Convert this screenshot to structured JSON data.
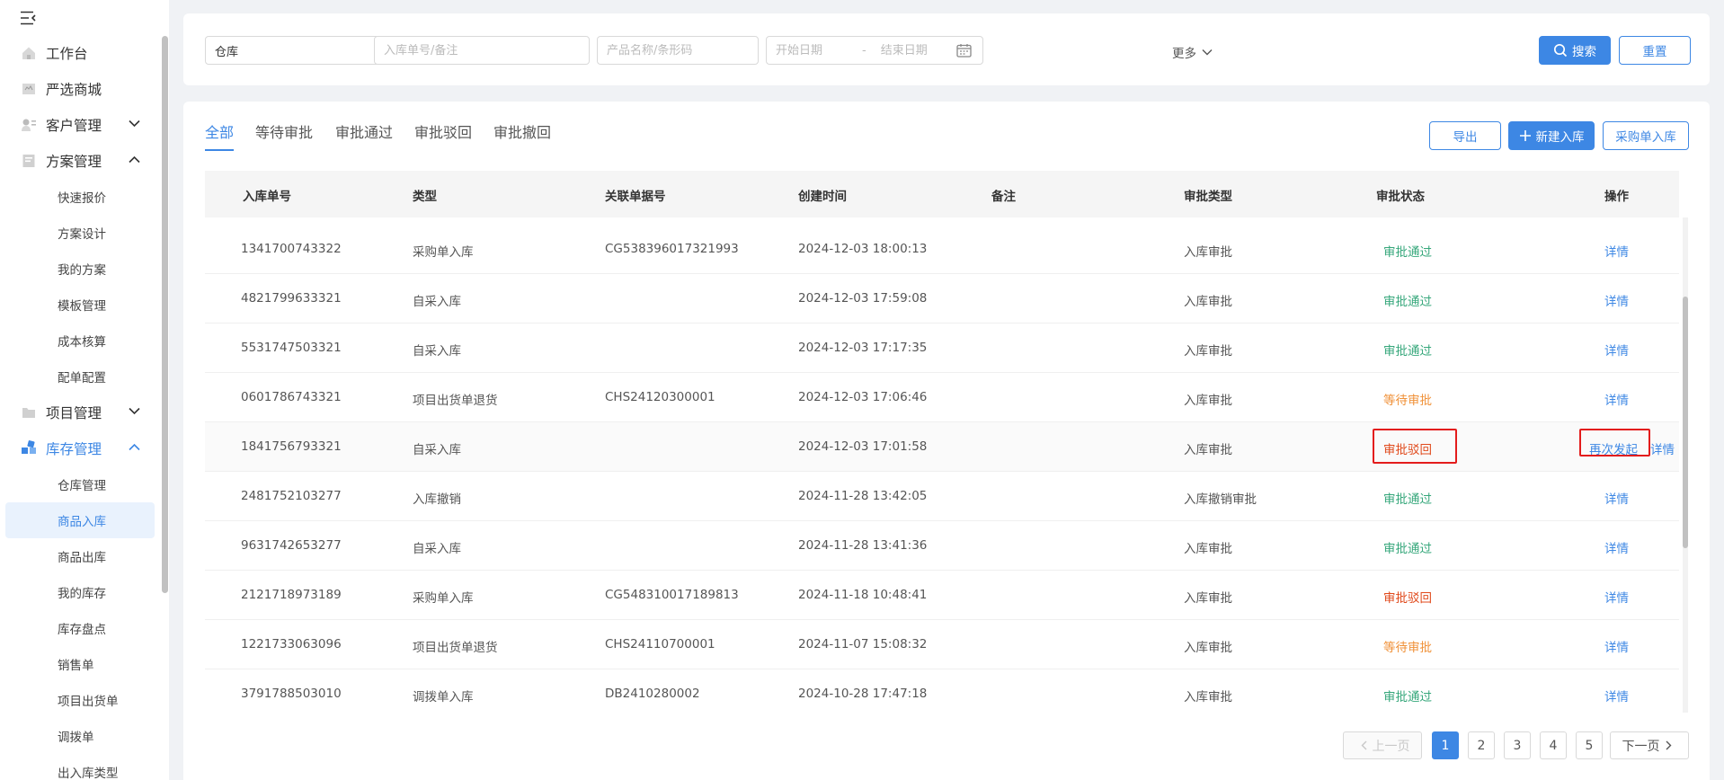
{
  "sidebar": {
    "nav": [
      {
        "label": "工作台",
        "icon": "home-icon"
      },
      {
        "label": "严选商城",
        "icon": "mall-icon"
      },
      {
        "label": "客户管理",
        "icon": "customer-icon",
        "expanded": false
      },
      {
        "label": "方案管理",
        "icon": "plan-icon",
        "expanded": true
      },
      {
        "label": "项目管理",
        "icon": "folder-icon",
        "expanded": false
      },
      {
        "label": "库存管理",
        "icon": "inventory-icon",
        "expanded": true
      }
    ],
    "plan_sub": [
      "快速报价",
      "方案设计",
      "我的方案",
      "模板管理",
      "成本核算",
      "配单配置"
    ],
    "inventory_sub": [
      "仓库管理",
      "商品入库",
      "商品出库",
      "我的库存",
      "库存盘点",
      "销售单",
      "项目出货单",
      "调拨单",
      "出入库类型"
    ],
    "selected": "商品入库"
  },
  "filters": {
    "warehouse": "仓库",
    "order_placeholder": "入库单号/备注",
    "product_placeholder": "产品名称/条形码",
    "start_placeholder": "开始日期",
    "date_sep": "-",
    "end_placeholder": "结束日期",
    "more_label": "更多",
    "search_label": "搜索",
    "reset_label": "重置"
  },
  "tabs": [
    "全部",
    "等待审批",
    "审批通过",
    "审批驳回",
    "审批撤回"
  ],
  "actions": {
    "export_label": "导出",
    "new_label": "新建入库",
    "purchase_label": "采购单入库"
  },
  "table": {
    "headers": [
      "入库单号",
      "类型",
      "关联单据号",
      "创建时间",
      "备注",
      "审批类型",
      "审批状态",
      "操作"
    ],
    "rows": [
      {
        "id": "1341700743322",
        "type": "采购单入库",
        "ref": "CG538396017321993",
        "time": "2024-12-03 18:00:13",
        "note": "",
        "approval_type": "入库审批",
        "status": "审批通过",
        "status_kind": "pass",
        "action": "详情"
      },
      {
        "id": "4821799633321",
        "type": "自采入库",
        "ref": "",
        "time": "2024-12-03 17:59:08",
        "note": "",
        "approval_type": "入库审批",
        "status": "审批通过",
        "status_kind": "pass",
        "action": "详情"
      },
      {
        "id": "5531747503321",
        "type": "自采入库",
        "ref": "",
        "time": "2024-12-03 17:17:35",
        "note": "",
        "approval_type": "入库审批",
        "status": "审批通过",
        "status_kind": "pass",
        "action": "详情"
      },
      {
        "id": "0601786743321",
        "type": "项目出货单退货",
        "ref": "CHS24120300001",
        "time": "2024-12-03 17:06:46",
        "note": "",
        "approval_type": "入库审批",
        "status": "等待审批",
        "status_kind": "wait",
        "action": "详情"
      },
      {
        "id": "1841756793321",
        "type": "自采入库",
        "ref": "",
        "time": "2024-12-03 17:01:58",
        "note": "",
        "approval_type": "入库审批",
        "status": "审批驳回",
        "status_kind": "reject",
        "action": "详情",
        "extra_action": "再次发起"
      },
      {
        "id": "2481752103277",
        "type": "入库撤销",
        "ref": "",
        "time": "2024-11-28 13:42:05",
        "note": "",
        "approval_type": "入库撤销审批",
        "status": "审批通过",
        "status_kind": "pass",
        "action": "详情"
      },
      {
        "id": "9631742653277",
        "type": "自采入库",
        "ref": "",
        "time": "2024-11-28 13:41:36",
        "note": "",
        "approval_type": "入库审批",
        "status": "审批通过",
        "status_kind": "pass",
        "action": "详情"
      },
      {
        "id": "2121718973189",
        "type": "采购单入库",
        "ref": "CG548310017189813",
        "time": "2024-11-18 10:48:41",
        "note": "",
        "approval_type": "入库审批",
        "status": "审批驳回",
        "status_kind": "reject",
        "action": "详情"
      },
      {
        "id": "1221733063096",
        "type": "项目出货单退货",
        "ref": "CHS24110700001",
        "time": "2024-11-07 15:08:32",
        "note": "",
        "approval_type": "入库审批",
        "status": "等待审批",
        "status_kind": "wait",
        "action": "详情"
      },
      {
        "id": "3791788503010",
        "type": "调拨单入库",
        "ref": "DB2410280002",
        "time": "2024-10-28 17:47:18",
        "note": "",
        "approval_type": "入库审批",
        "status": "审批通过",
        "status_kind": "pass",
        "action": "详情"
      }
    ]
  },
  "pagination": {
    "prev_label": "上一页",
    "pages": [
      "1",
      "2",
      "3",
      "4",
      "5"
    ],
    "current": "1",
    "next_label": "下一页"
  },
  "colors": {
    "accent": "#3d87e4",
    "pass": "#36a77b",
    "wait": "#f0923a",
    "reject": "#e04a1c",
    "highlight_box": "#e31c1c"
  }
}
